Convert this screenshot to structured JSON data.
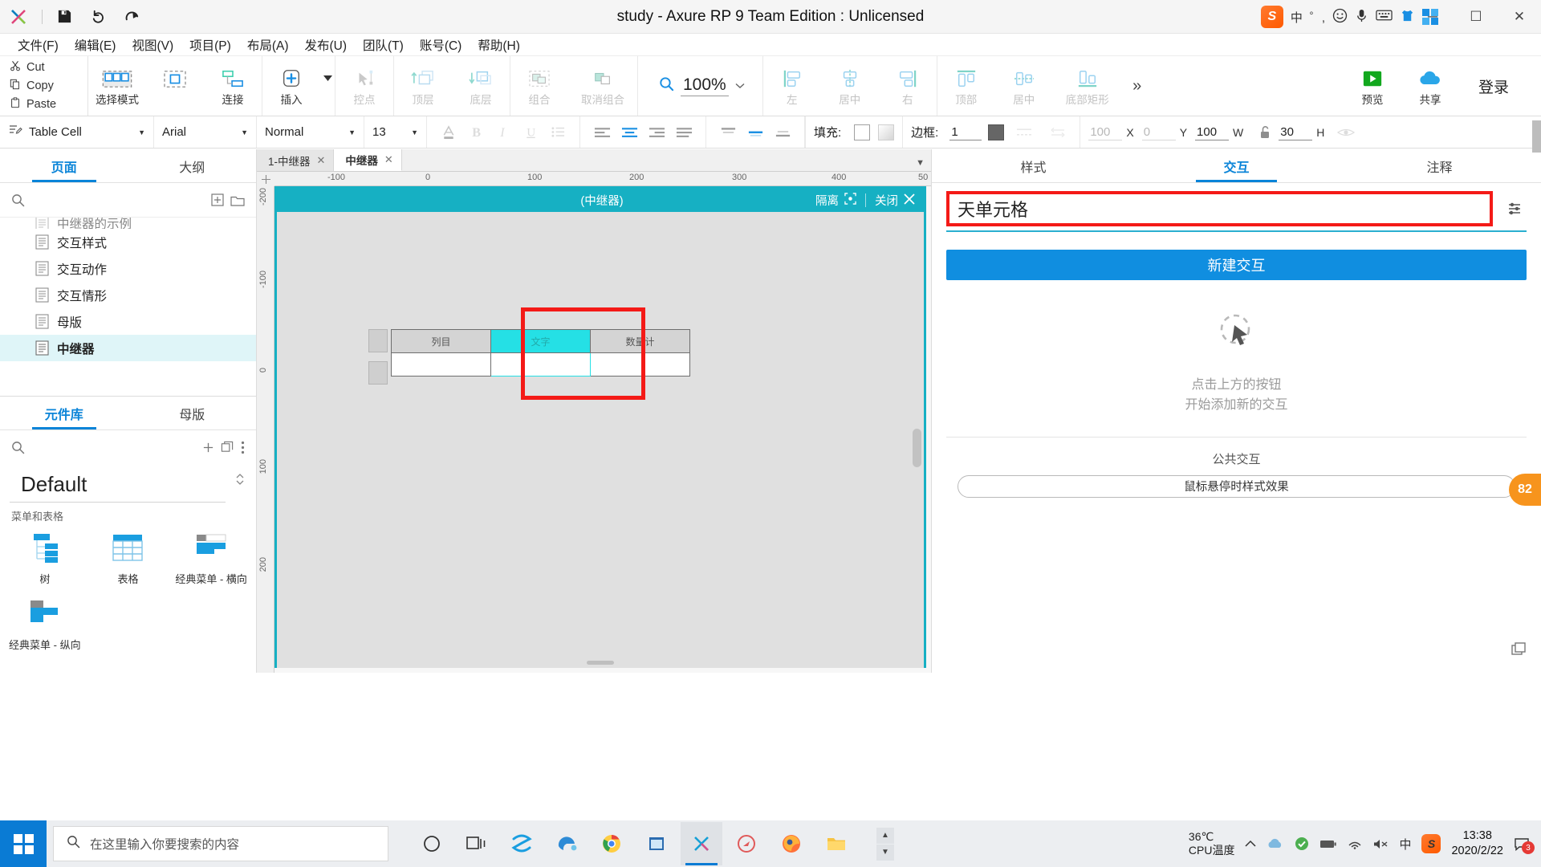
{
  "window": {
    "title": "study - Axure RP 9 Team Edition : Unlicensed",
    "minimize": "─",
    "maximize": "☐",
    "close": "✕",
    "ime_lang": "中",
    "ime_punct": "゜,"
  },
  "menu": {
    "items": [
      {
        "label": "文件(F)"
      },
      {
        "label": "编辑(E)"
      },
      {
        "label": "视图(V)"
      },
      {
        "label": "项目(P)"
      },
      {
        "label": "布局(A)"
      },
      {
        "label": "发布(U)"
      },
      {
        "label": "团队(T)"
      },
      {
        "label": "账号(C)"
      },
      {
        "label": "帮助(H)"
      }
    ]
  },
  "clipboard": {
    "cut": "Cut",
    "copy": "Copy",
    "paste": "Paste"
  },
  "ribbon": {
    "buttons": [
      {
        "label": "选择模式",
        "name": "select-mode",
        "disabled": false
      },
      {
        "label": "连接",
        "name": "connect",
        "disabled": false
      },
      {
        "label": "插入",
        "name": "insert",
        "disabled": false
      },
      {
        "label": "控点",
        "name": "control-point",
        "disabled": true
      },
      {
        "label": "顶层",
        "name": "bring-to-front",
        "disabled": true
      },
      {
        "label": "底层",
        "name": "send-to-back",
        "disabled": true
      },
      {
        "label": "组合",
        "name": "group",
        "disabled": true
      },
      {
        "label": "取消组合",
        "name": "ungroup",
        "disabled": true
      },
      {
        "label": "左",
        "name": "align-left",
        "disabled": true
      },
      {
        "label": "居中",
        "name": "align-center",
        "disabled": true
      },
      {
        "label": "右",
        "name": "align-right",
        "disabled": true
      },
      {
        "label": "顶部",
        "name": "align-top",
        "disabled": true
      },
      {
        "label": "居中",
        "name": "align-middle",
        "disabled": true
      },
      {
        "label": "底部矩形",
        "name": "align-bottom",
        "disabled": true
      }
    ],
    "zoom": "100%",
    "more": "»",
    "preview": "预览",
    "share": "共享",
    "login": "登录"
  },
  "format": {
    "style": "Table Cell",
    "font": "Arial",
    "weight": "Normal",
    "size": "13",
    "fill_label": "填充:",
    "border_label": "边框:",
    "border_width": "1",
    "x_value": "100",
    "x_label": "X",
    "y_value": "0",
    "y_label": "Y",
    "w_value": "100",
    "w_label": "W",
    "h_value": "30",
    "h_label": "H"
  },
  "pages_panel": {
    "tabs": [
      {
        "label": "页面",
        "active": true
      },
      {
        "label": "大纲",
        "active": false
      }
    ],
    "items": [
      {
        "label": "中继器的示例",
        "clipped": true,
        "selected": false
      },
      {
        "label": "交互样式",
        "clipped": false,
        "selected": false
      },
      {
        "label": "交互动作",
        "clipped": false,
        "selected": false
      },
      {
        "label": "交互情形",
        "clipped": false,
        "selected": false
      },
      {
        "label": "母版",
        "clipped": false,
        "selected": false
      },
      {
        "label": "中继器",
        "clipped": false,
        "selected": true
      }
    ]
  },
  "library_panel": {
    "tabs": [
      {
        "label": "元件库",
        "active": true
      },
      {
        "label": "母版",
        "active": false
      }
    ],
    "library_name": "Default",
    "group_label": "菜单和表格",
    "widgets": [
      {
        "label": "树",
        "name": "tree"
      },
      {
        "label": "表格",
        "name": "table"
      },
      {
        "label": "经典菜单 - 横向",
        "name": "classic-menu-horizontal"
      },
      {
        "label": "经典菜单 - 纵向",
        "name": "classic-menu-vertical"
      }
    ]
  },
  "canvas": {
    "tabs": [
      {
        "label": "1-中继器",
        "active": false
      },
      {
        "label": "中继器",
        "active": true
      }
    ],
    "ruler_h": [
      "-100",
      "0",
      "100",
      "200",
      "300",
      "400",
      "50"
    ],
    "ruler_v": [
      "-200",
      "-100",
      "0",
      "100",
      "200"
    ],
    "repeater": {
      "title": "(中继器)",
      "isolate": "隔离",
      "close": "关闭"
    },
    "table": {
      "header": [
        "列目",
        "文字",
        "数量计"
      ],
      "row": [
        "",
        "",
        ""
      ]
    }
  },
  "inspector": {
    "tabs": [
      {
        "label": "样式",
        "active": false
      },
      {
        "label": "交互",
        "active": true
      },
      {
        "label": "注释",
        "active": false
      }
    ],
    "widget_name": "天单元格",
    "new_interaction": "新建交互",
    "hint_line1": "点击上方的按钮",
    "hint_line2": "开始添加新的交互",
    "common_title": "公共交互",
    "common_item": "鼠标悬停时样式效果"
  },
  "float_badge": {
    "value": "82"
  },
  "taskbar": {
    "search_placeholder": "在这里输入你要搜索的内容",
    "temp_value": "36℃",
    "temp_label": "CPU温度",
    "lang": "中",
    "time": "13:38",
    "date": "2020/2/22",
    "notif_count": "3"
  },
  "colors": {
    "accent_blue": "#108ee0",
    "teal": "#16b0c3",
    "cyan_cell": "#25e0e5",
    "red_highlight": "#f41a17",
    "orange_badge": "#f7941d"
  }
}
